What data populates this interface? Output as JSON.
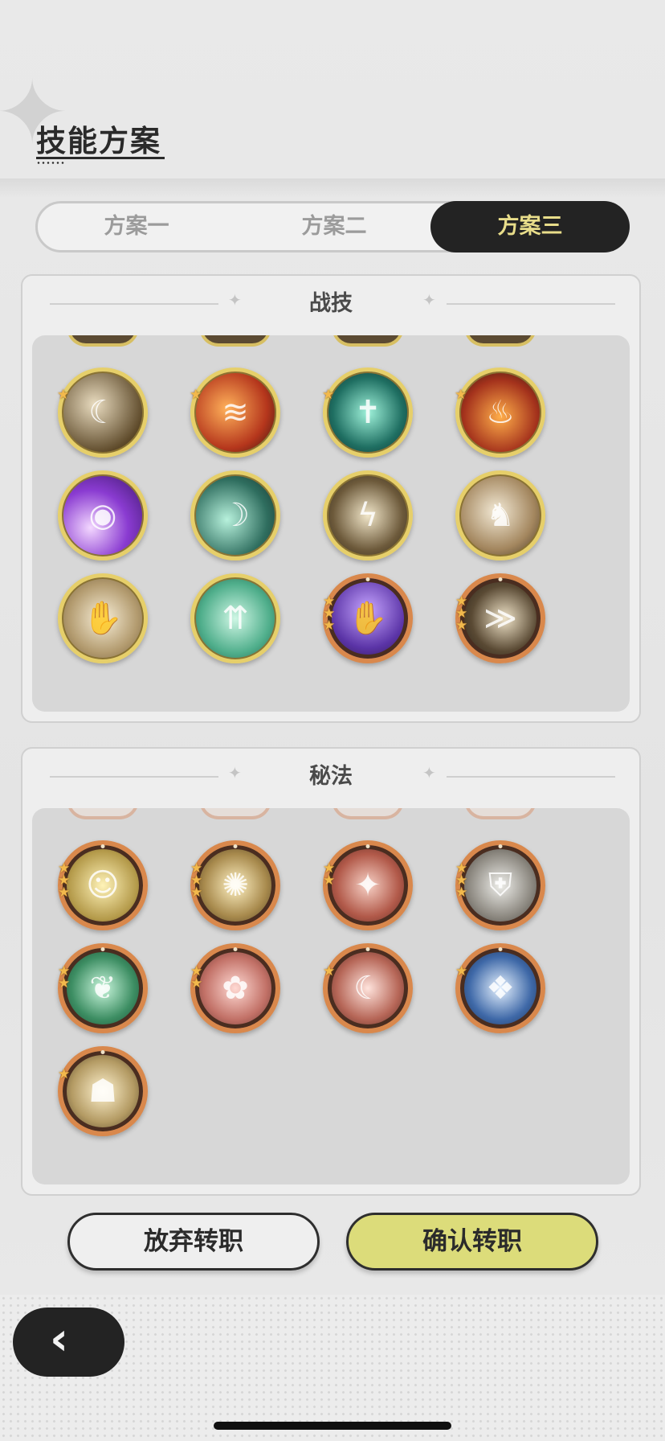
{
  "header": {
    "title": "技能方案"
  },
  "tabs": [
    {
      "label": "方案一",
      "active": false
    },
    {
      "label": "方案二",
      "active": false
    },
    {
      "label": "方案三",
      "active": true
    }
  ],
  "sections": {
    "combat": {
      "title": "战技",
      "skills": [
        {
          "icon": "slash-claw-icon",
          "frame": "gold",
          "stars": 1
        },
        {
          "icon": "fire-slash-icon",
          "frame": "gold",
          "stars": 1
        },
        {
          "icon": "sword-burst-icon",
          "frame": "gold",
          "stars": 1
        },
        {
          "icon": "flame-icon",
          "frame": "gold",
          "stars": 1
        },
        {
          "icon": "purple-orb-icon",
          "frame": "gold",
          "stars": 0
        },
        {
          "icon": "green-crescent-icon",
          "frame": "gold",
          "stars": 0
        },
        {
          "icon": "lightning-slash-icon",
          "frame": "gold",
          "stars": 0
        },
        {
          "icon": "charge-beast-icon",
          "frame": "gold",
          "stars": 0
        },
        {
          "icon": "palm-strike-icon",
          "frame": "gold",
          "stars": 0
        },
        {
          "icon": "green-arrows-icon",
          "frame": "gold",
          "stars": 0
        },
        {
          "icon": "shadow-claw-icon",
          "frame": "orange",
          "stars": 3
        },
        {
          "icon": "whirl-slash-icon",
          "frame": "orange",
          "stars": 3
        }
      ]
    },
    "arcane": {
      "title": "秘法",
      "skills": [
        {
          "icon": "radiant-figure-icon",
          "frame": "orange",
          "stars": 3
        },
        {
          "icon": "golden-vortex-icon",
          "frame": "orange",
          "stars": 3
        },
        {
          "icon": "crimson-strike-icon",
          "frame": "orange",
          "stars": 2
        },
        {
          "icon": "shield-figure-icon",
          "frame": "orange",
          "stars": 3
        },
        {
          "icon": "green-leaf-icon",
          "frame": "orange",
          "stars": 2
        },
        {
          "icon": "pink-bloom-icon",
          "frame": "orange",
          "stars": 2
        },
        {
          "icon": "crescent-slash-icon",
          "frame": "orange",
          "stars": 1
        },
        {
          "icon": "blue-crystal-icon",
          "frame": "orange",
          "stars": 1
        },
        {
          "icon": "guardian-figure-icon",
          "frame": "orange",
          "stars": 1
        }
      ]
    }
  },
  "buttons": {
    "cancel": "放弃转职",
    "confirm": "确认转职"
  },
  "back": {
    "icon": "chevron-left-icon"
  },
  "colors": {
    "accent": "#e8dd8a",
    "confirm": "#dcdc7a",
    "dark": "#232323"
  }
}
